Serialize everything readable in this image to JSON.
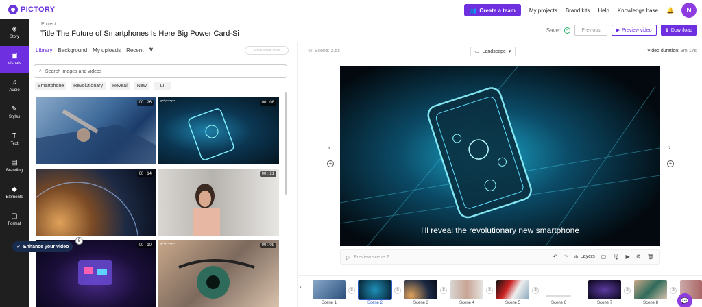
{
  "brand": {
    "name": "PICTORY",
    "accent": "#6d2fe0"
  },
  "topnav": {
    "create_team": "Create a team",
    "links": [
      "My projects",
      "Brand kits",
      "Help",
      "Knowledge base"
    ],
    "avatar_initial": "N"
  },
  "project": {
    "label": "Project",
    "title": "Title The Future of Smartphones Is Here  Big Power Card-Si",
    "saved": "Saved",
    "previous": "Previous",
    "preview_video": "Preview video",
    "download": "Download"
  },
  "sidebar": {
    "items": [
      {
        "label": "Story",
        "icon": "layers-icon"
      },
      {
        "label": "Visuals",
        "icon": "image-icon",
        "active": true
      },
      {
        "label": "Audio",
        "icon": "music-icon"
      },
      {
        "label": "Styles",
        "icon": "brush-icon"
      },
      {
        "label": "Text",
        "icon": "text-icon"
      },
      {
        "label": "Branding",
        "icon": "branding-icon"
      },
      {
        "label": "Elements",
        "icon": "shapes-icon"
      },
      {
        "label": "Format",
        "icon": "format-icon"
      }
    ]
  },
  "library": {
    "tabs": [
      "Library",
      "Background",
      "My uploads",
      "Recent"
    ],
    "apply_all": "Apply visual to all",
    "search_placeholder": "Search images and videos",
    "chips": [
      "Smartphone",
      "Revolutionary",
      "Reveal",
      "New",
      "LI"
    ],
    "thumbs": [
      {
        "duration": "00 : 26",
        "getty": ""
      },
      {
        "duration": "00 : 08",
        "getty": "gettyimages"
      },
      {
        "duration": "00 : 14",
        "getty": ""
      },
      {
        "duration": "00 : 21",
        "getty": ""
      },
      {
        "duration": "00 : 10",
        "getty": "gettyimages"
      },
      {
        "duration": "00 : 09",
        "getty": "gettyimages"
      }
    ],
    "enhance": "Enhance your video",
    "enhance_badge": "5"
  },
  "editor": {
    "scene_info": "Scene: 2.5s",
    "orientation": "Landscape",
    "video_duration_label": "Video duration:",
    "video_duration_value": "3m 17s",
    "caption": "I'll reveal the revolutionary new smartphone",
    "preview_scene": "Preview scene 2",
    "layers": "Layers"
  },
  "timeline": {
    "scenes": [
      "Scene 1",
      "Scene 2",
      "Scene 3",
      "Scene 4",
      "Scene 5",
      "Scene 6",
      "Scene 7",
      "Scene 8"
    ],
    "active_scene": "Scene 2"
  }
}
